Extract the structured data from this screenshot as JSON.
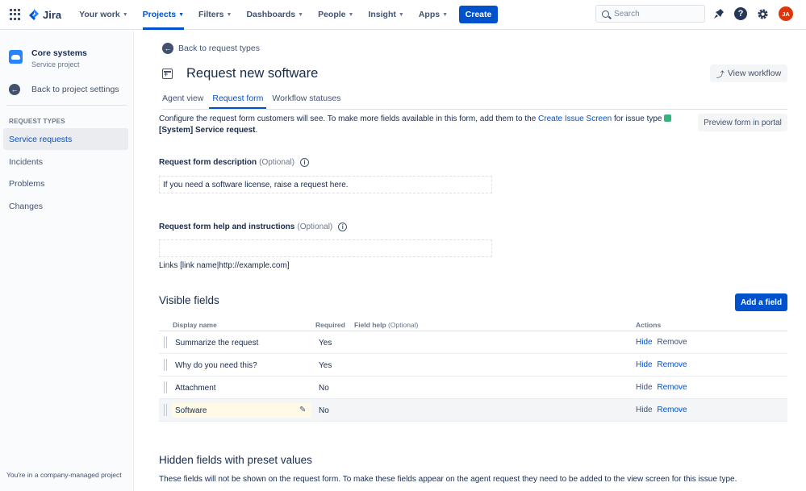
{
  "topnav": {
    "logo_text": "Jira",
    "items": [
      {
        "label": "Your work"
      },
      {
        "label": "Projects"
      },
      {
        "label": "Filters"
      },
      {
        "label": "Dashboards"
      },
      {
        "label": "People"
      },
      {
        "label": "Insight"
      },
      {
        "label": "Apps"
      }
    ],
    "active_item": "Projects",
    "create_label": "Create",
    "search_placeholder": "Search",
    "avatar_initials": "JA",
    "accent_color": "#0052cc"
  },
  "sidebar": {
    "project_name": "Core systems",
    "project_type": "Service project",
    "back_label": "Back to project settings",
    "section_title": "REQUEST TYPES",
    "items": [
      {
        "label": "Service requests"
      },
      {
        "label": "Incidents"
      },
      {
        "label": "Problems"
      },
      {
        "label": "Changes"
      }
    ],
    "active_item": "Service requests",
    "footer": "You're in a company-managed project"
  },
  "main": {
    "back_label": "Back to request types",
    "title": "Request new software",
    "view_workflow_label": "View workflow",
    "tabs": [
      {
        "label": "Agent view"
      },
      {
        "label": "Request form"
      },
      {
        "label": "Workflow statuses"
      }
    ],
    "active_tab": "Request form",
    "description_pre": "Configure the request form customers will see. To make more fields available in this form, add them to the",
    "description_link": "Create Issue Screen",
    "description_mid": "for issue type",
    "description_issue_type": "[System] Service request",
    "description_end": ".",
    "preview_label": "Preview form in portal",
    "form_description": {
      "label": "Request form description",
      "optional": "(Optional)",
      "value": "If you need a software license, raise a request here."
    },
    "form_help": {
      "label": "Request form help and instructions",
      "optional": "(Optional)",
      "value": ""
    },
    "links_hint": "Links [link name|http://example.com]",
    "visible_fields_title": "Visible fields",
    "add_field_label": "Add a field",
    "table": {
      "headers": {
        "display_name": "Display name",
        "required": "Required",
        "field_help": "Field help",
        "field_help_optional": "(Optional)",
        "actions": "Actions"
      },
      "rows": [
        {
          "name": "Summarize the request",
          "required": "Yes",
          "hide": "Hide",
          "remove": "Remove"
        },
        {
          "name": "Why do you need this?",
          "required": "Yes",
          "hide": "Hide",
          "remove": "Remove"
        },
        {
          "name": "Attachment",
          "required": "No",
          "hide": "Hide",
          "remove": "Remove"
        },
        {
          "name": "Software",
          "required": "No",
          "hide": "Hide",
          "remove": "Remove"
        }
      ]
    },
    "hidden_fields_title": "Hidden fields with preset values",
    "hidden_fields_desc": "These fields will not be shown on the request form. To make these fields appear on the agent request they need to be added to the view screen for this issue type."
  }
}
